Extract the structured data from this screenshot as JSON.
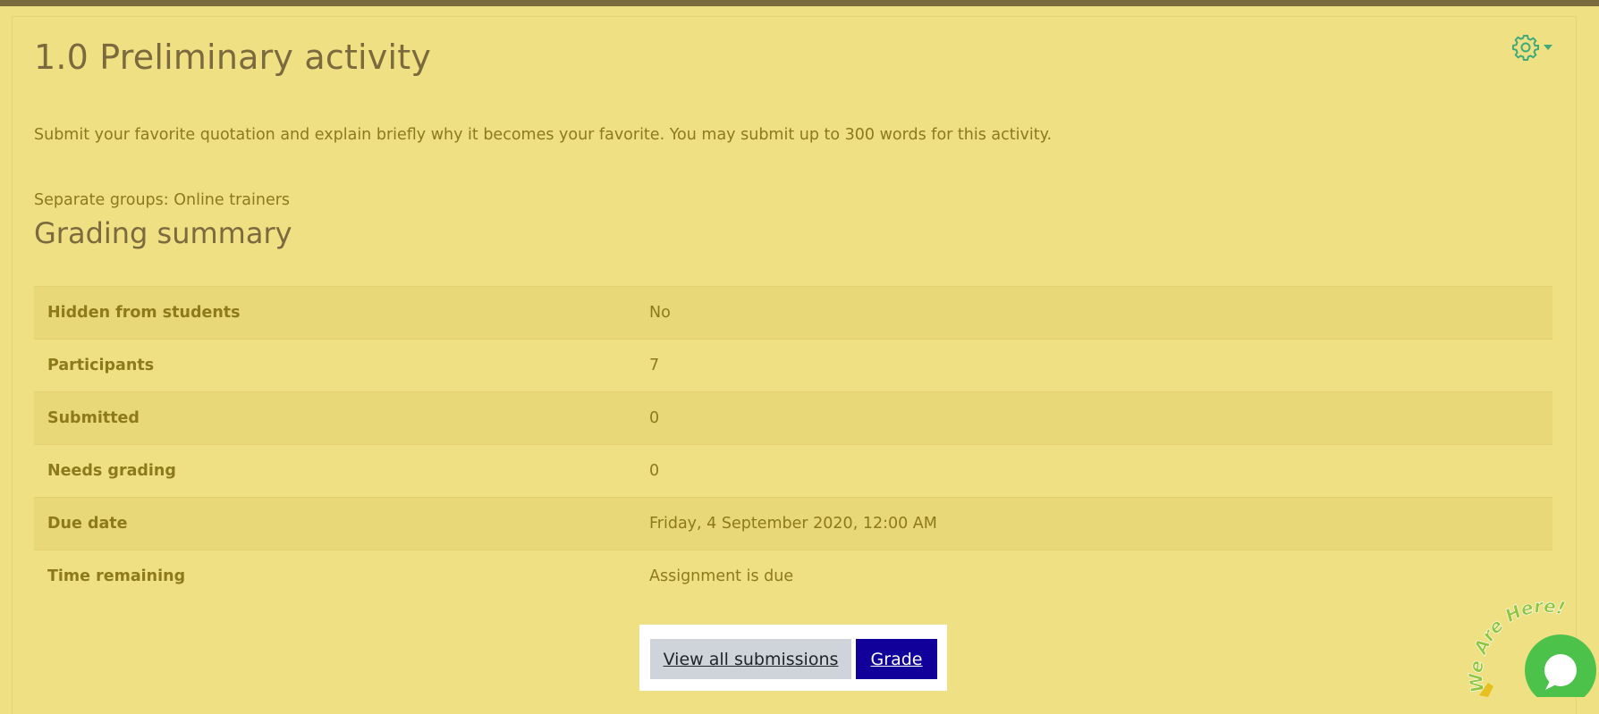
{
  "page": {
    "title": "1.0 Preliminary activity",
    "intro": "Submit your favorite quotation and explain briefly why it becomes your favorite. You may submit up to 300 words for this activity.",
    "groups_label": "Separate groups: Online trainers",
    "summary_heading": "Grading summary"
  },
  "settings_menu": {
    "icon": "gear-icon"
  },
  "summary": {
    "rows": [
      {
        "label": "Hidden from students",
        "value": "No"
      },
      {
        "label": "Participants",
        "value": "7"
      },
      {
        "label": "Submitted",
        "value": "0"
      },
      {
        "label": "Needs grading",
        "value": "0"
      },
      {
        "label": "Due date",
        "value": "Friday, 4 September 2020, 12:00 AM"
      },
      {
        "label": "Time remaining",
        "value": "Assignment is due"
      }
    ]
  },
  "actions": {
    "view_all_label": "View all submissions",
    "grade_label": "Grade"
  },
  "chat_widget": {
    "text": "We Are Here!",
    "icon": "chat-bubble-icon"
  },
  "colors": {
    "page_bg": "#f0e084",
    "accent_text": "#7a6a3e",
    "body_text": "#8c7a1c",
    "grade_button": "#12009a",
    "view_button": "#ced4da",
    "gear": "#3faa7a",
    "chat_green": "#4cc24a"
  }
}
